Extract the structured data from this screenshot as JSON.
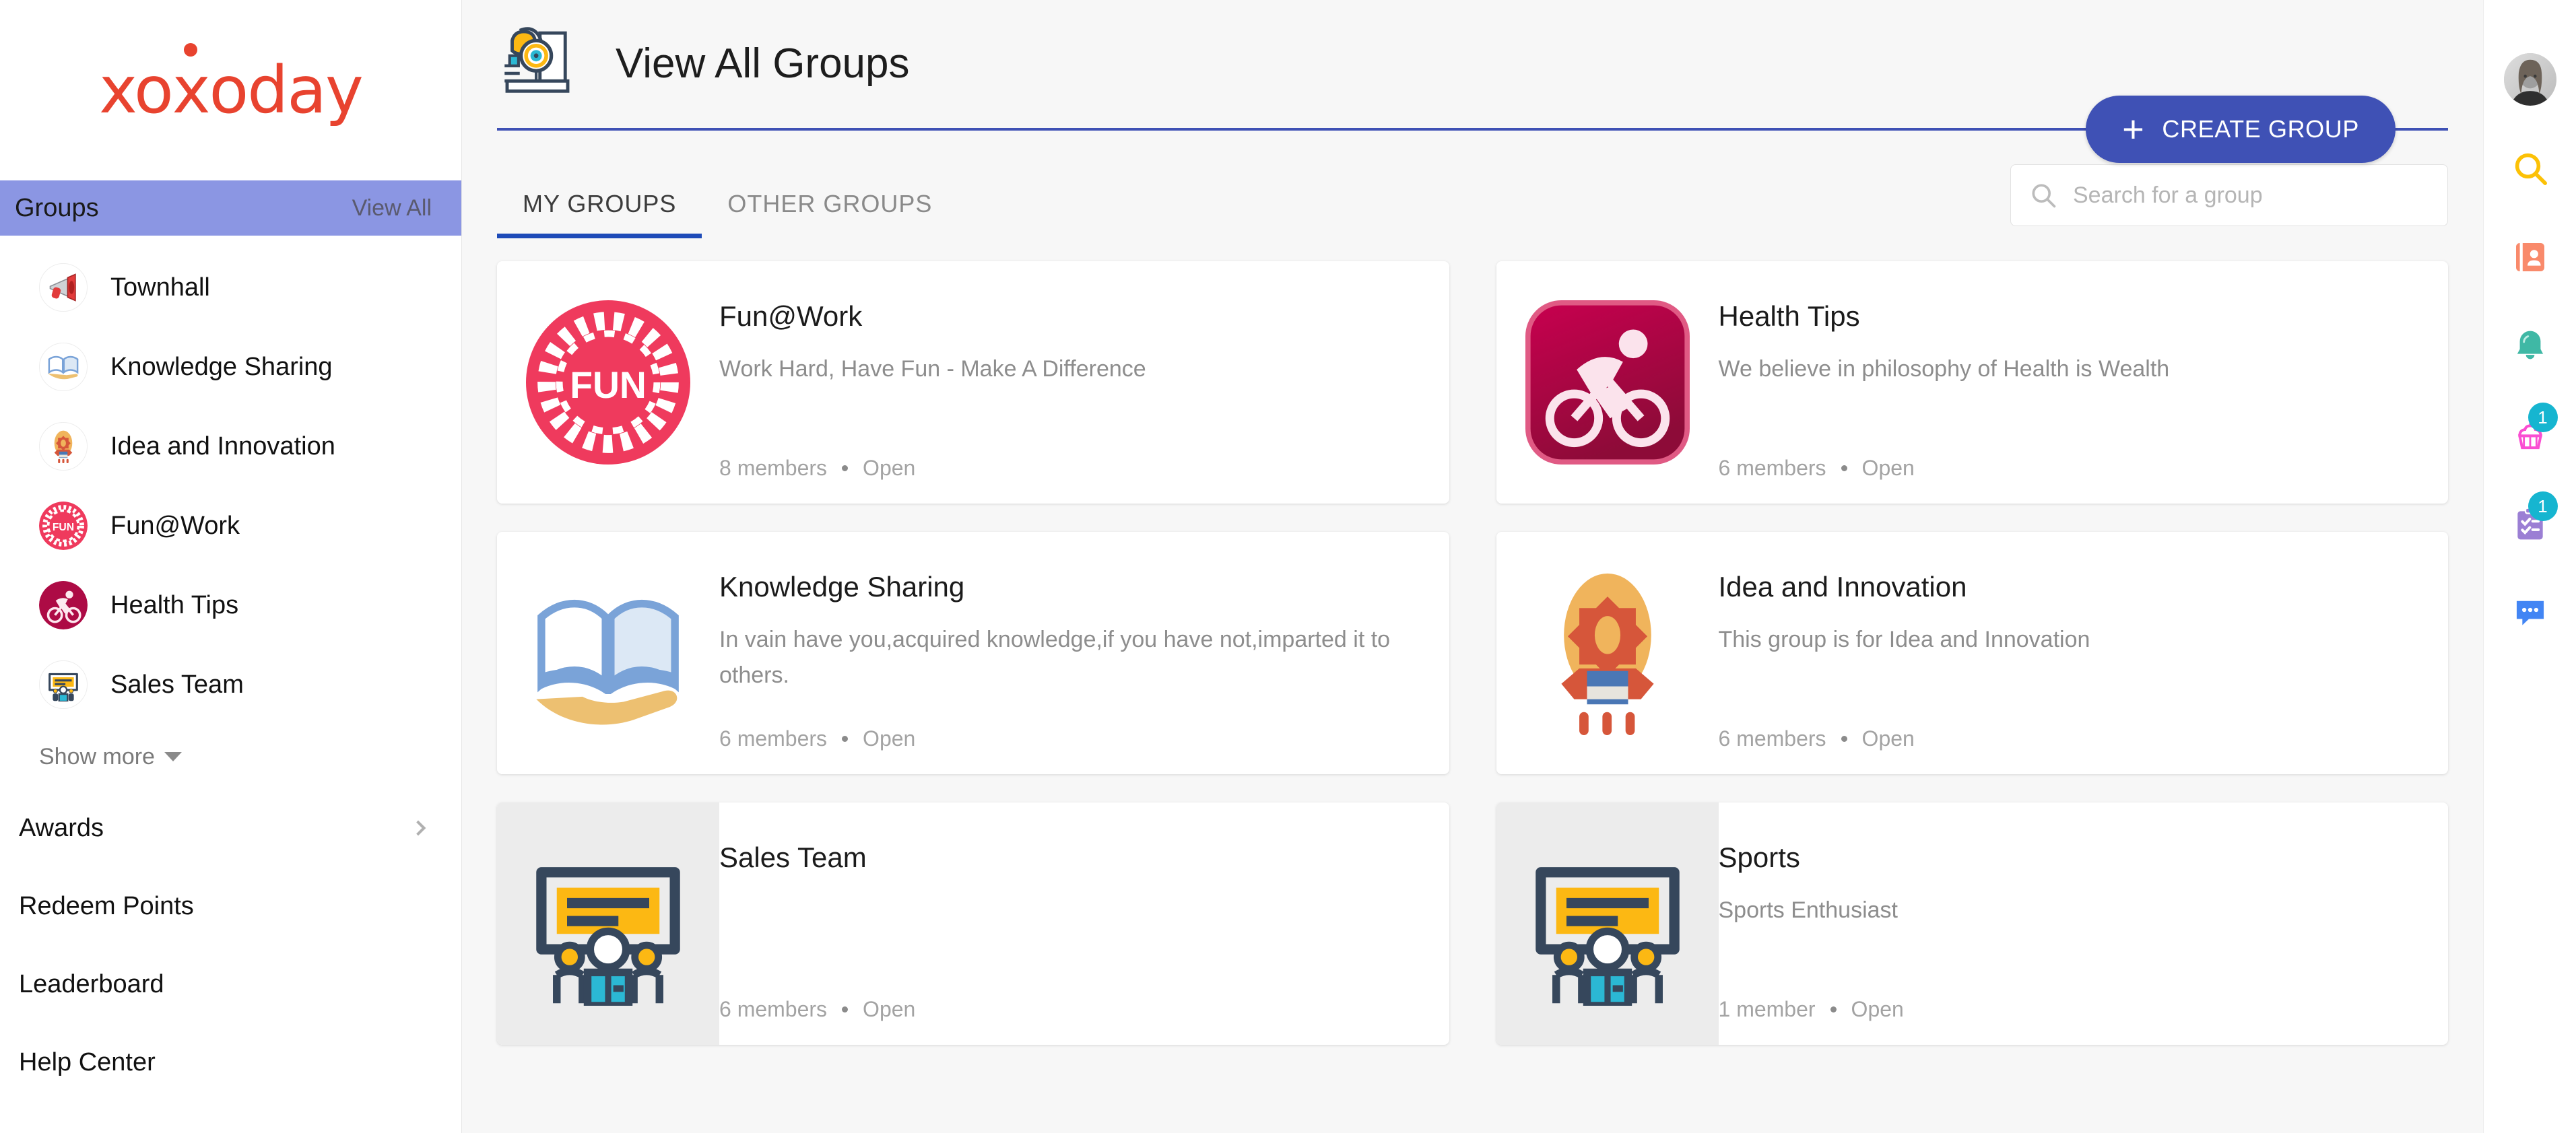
{
  "brand": {
    "name": "xoxoday"
  },
  "sidebar": {
    "groups_header": {
      "title": "Groups",
      "view_all": "View All"
    },
    "groups": [
      {
        "label": "Townhall",
        "icon": "megaphone-icon"
      },
      {
        "label": "Knowledge Sharing",
        "icon": "open-book-hand-icon"
      },
      {
        "label": "Idea and Innovation",
        "icon": "rocket-gear-icon"
      },
      {
        "label": "Fun@Work",
        "icon": "fun-gear-icon"
      },
      {
        "label": "Health Tips",
        "icon": "cyclist-icon"
      },
      {
        "label": "Sales Team",
        "icon": "presentation-team-icon"
      }
    ],
    "show_more": "Show more",
    "menu": [
      {
        "label": "Awards",
        "has_chevron": true
      },
      {
        "label": "Redeem Points",
        "has_chevron": false
      },
      {
        "label": "Leaderboard",
        "has_chevron": false
      },
      {
        "label": "Help Center",
        "has_chevron": false
      }
    ]
  },
  "header": {
    "title": "View All Groups",
    "icon": "group-search-icon",
    "create_group_label": "CREATE GROUP",
    "create_group_plus": "+"
  },
  "tabs": [
    {
      "label": "MY GROUPS",
      "active": true
    },
    {
      "label": "OTHER GROUPS",
      "active": false
    }
  ],
  "search": {
    "placeholder": "Search for a group",
    "value": "",
    "icon": "search-icon"
  },
  "cards": [
    {
      "title": "Fun@Work",
      "description": "Work Hard, Have Fun - Make A Difference",
      "members": "8 members",
      "privacy": "Open",
      "icon": "fun-gear-icon",
      "avatar_bg": "#ffffff"
    },
    {
      "title": "Health Tips",
      "description": "We believe in philosophy of Health is Wealth",
      "members": "6 members",
      "privacy": "Open",
      "icon": "cyclist-icon",
      "avatar_bg": "#ffffff"
    },
    {
      "title": "Knowledge Sharing",
      "description": "In vain have you,acquired knowledge,if you have not,imparted it to others.",
      "members": "6 members",
      "privacy": "Open",
      "icon": "open-book-hand-icon",
      "avatar_bg": "#ffffff"
    },
    {
      "title": "Idea and Innovation",
      "description": "This group is for Idea and Innovation",
      "members": "6 members",
      "privacy": "Open",
      "icon": "rocket-gear-icon",
      "avatar_bg": "#ffffff"
    },
    {
      "title": "Sales Team",
      "description": "",
      "members": "6 members",
      "privacy": "Open",
      "icon": "presentation-team-icon",
      "avatar_bg": "#ececec"
    },
    {
      "title": "Sports",
      "description": "Sports Enthusiast",
      "members": "1 member",
      "privacy": "Open",
      "icon": "presentation-team-icon",
      "avatar_bg": "#ececec"
    }
  ],
  "right_rail": [
    {
      "name": "user-avatar",
      "icon": "avatar",
      "badge": ""
    },
    {
      "name": "search",
      "icon": "search-icon",
      "badge": "",
      "color": "#fcc106"
    },
    {
      "name": "directory",
      "icon": "contacts-book-icon",
      "badge": "",
      "color": "#f98a6b"
    },
    {
      "name": "notifications",
      "icon": "bell-icon",
      "badge": "",
      "color": "#3fb8a5"
    },
    {
      "name": "celebrations",
      "icon": "cupcake-icon",
      "badge": "1",
      "color": "#fa4ed2"
    },
    {
      "name": "tasks",
      "icon": "clipboard-check-icon",
      "badge": "1",
      "color": "#9b7fd4"
    },
    {
      "name": "chat",
      "icon": "chat-bubble-icon",
      "badge": "",
      "color": "#4285f4"
    }
  ],
  "colors": {
    "accent_blue": "#3f51b5",
    "tab_underline": "#1e4bb8",
    "sidebar_header": "#8b96e3",
    "brand_red": "#e8432f",
    "badge_teal": "#16b5d0",
    "page_bg": "#f7f7f7"
  }
}
